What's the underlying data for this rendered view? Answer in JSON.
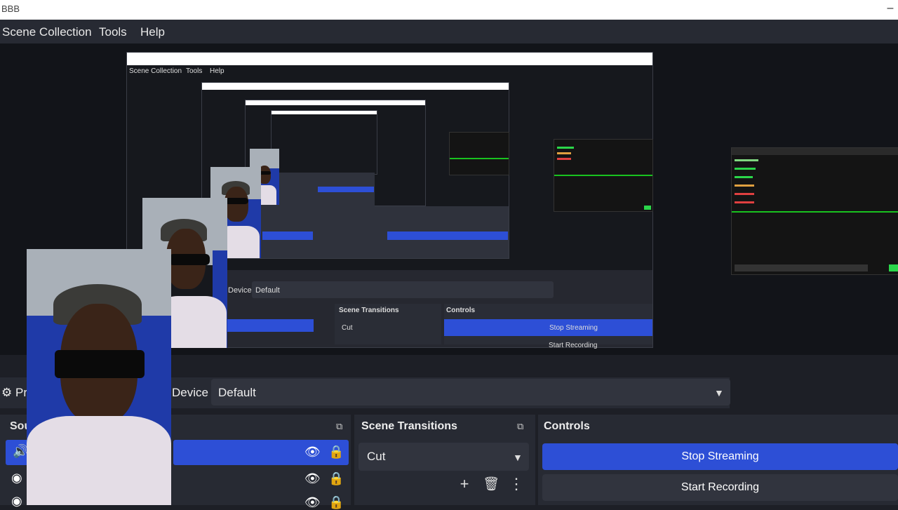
{
  "window": {
    "title": "BBB"
  },
  "menu": [
    "Scene Collection",
    "Tools",
    "Help"
  ],
  "preview": {
    "nested_menu": [
      "Scene Collection",
      "Tools",
      "Help"
    ],
    "nested_device_label": "Device",
    "nested_device_value": "Default",
    "nested_transitions_title": "Scene Transitions",
    "nested_controls_title": "Controls",
    "nested_transition_value": "Cut",
    "nested_stop": "Stop Streaming",
    "nested_start": "Start Recording"
  },
  "properties_bar": {
    "properties_fragment": "Pr",
    "device_label": "Device",
    "device_value": "Default"
  },
  "sources": {
    "title_fragment": "Sou"
  },
  "scene_transitions": {
    "title": "Scene Transitions",
    "selected": "Cut"
  },
  "controls": {
    "title": "Controls",
    "stop_streaming": "Stop Streaming",
    "start_recording": "Start Recording"
  },
  "icons": {
    "gear": "gear-icon",
    "eye": "eye-icon",
    "lock": "lock-icon",
    "add": "add-icon",
    "trash": "trash-icon",
    "more": "more-icon",
    "undock": "undock-icon",
    "caret": "chevron-down-icon"
  },
  "colors": {
    "accent": "#2d4fd6",
    "panel": "#272a33",
    "background": "#1d1f26"
  }
}
